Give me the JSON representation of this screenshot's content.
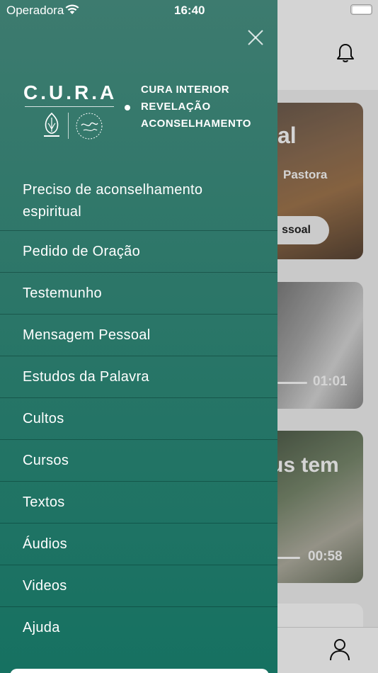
{
  "status_bar": {
    "carrier": "Operadora",
    "time": "16:40"
  },
  "background": {
    "card1": {
      "title": "al",
      "subtitle": "Pastora",
      "button_label": "ssoal"
    },
    "card2": {
      "duration": "01:01"
    },
    "card3": {
      "title_line1": "us tem",
      "title_line2": "!",
      "duration": "00:58"
    }
  },
  "drawer": {
    "logo": {
      "wordmark": "C.U.R.A",
      "line1": "CURA INTERIOR",
      "line2": "REVELAÇÃO",
      "line3": "ACONSELHAMENTO"
    },
    "menu": [
      {
        "label": "Preciso de aconselhamento espiritual"
      },
      {
        "label": "Pedido de Oração"
      },
      {
        "label": "Testemunho"
      },
      {
        "label": "Mensagem Pessoal"
      },
      {
        "label": "Estudos da Palavra"
      },
      {
        "label": "Cultos"
      },
      {
        "label": "Cursos"
      },
      {
        "label": "Textos"
      },
      {
        "label": "Áudios"
      },
      {
        "label": "Videos"
      },
      {
        "label": "Ajuda"
      }
    ]
  },
  "colors": {
    "drawer_top": "#3d7b6f",
    "drawer_bottom": "#167161",
    "text": "#ffffff"
  },
  "icons": {
    "close": "close-icon",
    "bell": "bell-icon",
    "user": "user-icon",
    "wifi": "wifi-icon",
    "battery": "battery-icon"
  }
}
